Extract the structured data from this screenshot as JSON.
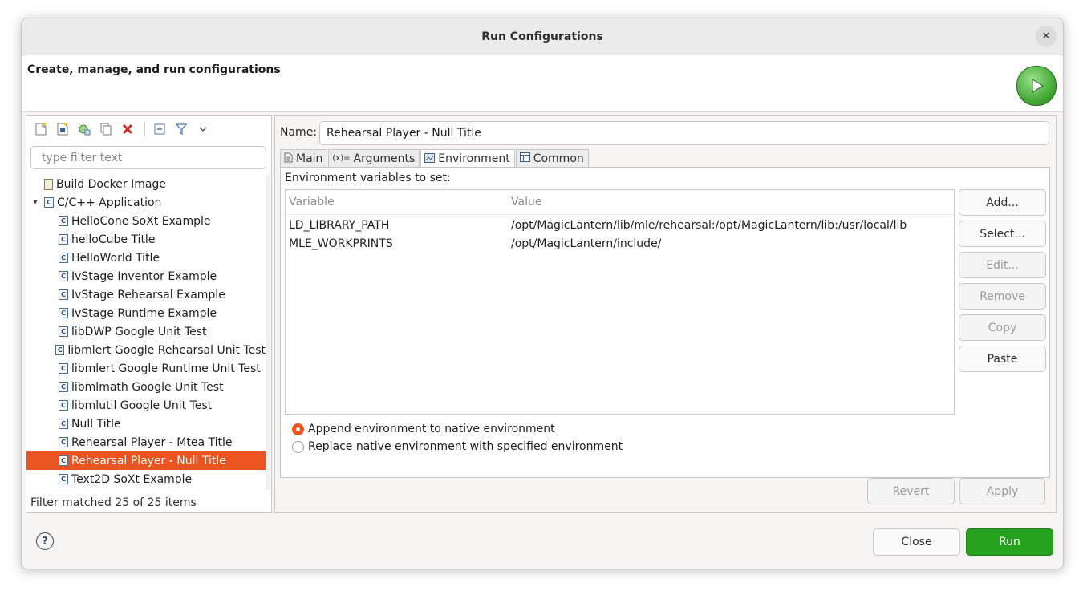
{
  "window": {
    "title": "Run Configurations",
    "close_glyph": "✕"
  },
  "banner": {
    "heading": "Create, manage, and run configurations",
    "icon": "run-icon"
  },
  "left": {
    "toolbar_icons": [
      "new-config-icon",
      "new-prototype-icon",
      "duplicate-icon",
      "copy-icon",
      "delete-icon",
      "collapse-all-icon",
      "filter-icon",
      "view-menu-icon"
    ],
    "filter_placeholder": "type filter text",
    "tree": [
      {
        "label": "Build Docker Image",
        "kind": "doc"
      },
      {
        "label": "C/C++ Application",
        "kind": "category",
        "expanded": true
      },
      {
        "label": "HelloCone SoXt Example",
        "kind": "c"
      },
      {
        "label": "helloCube Title",
        "kind": "c"
      },
      {
        "label": "HelloWorld Title",
        "kind": "c"
      },
      {
        "label": "IvStage Inventor Example",
        "kind": "c"
      },
      {
        "label": "IvStage Rehearsal Example",
        "kind": "c"
      },
      {
        "label": "IvStage Runtime Example",
        "kind": "c"
      },
      {
        "label": "libDWP Google Unit Test",
        "kind": "c"
      },
      {
        "label": "libmlert Google Rehearsal Unit Test",
        "kind": "c"
      },
      {
        "label": "libmlert Google Runtime Unit Test",
        "kind": "c"
      },
      {
        "label": "libmlmath Google Unit Test",
        "kind": "c"
      },
      {
        "label": "libmlutil Google Unit Test",
        "kind": "c"
      },
      {
        "label": "Null Title",
        "kind": "c"
      },
      {
        "label": "Rehearsal Player - Mtea Title",
        "kind": "c"
      },
      {
        "label": "Rehearsal Player - Null Title",
        "kind": "c",
        "selected": true
      },
      {
        "label": "Text2D SoXt Example",
        "kind": "c"
      }
    ],
    "status": "Filter matched 25 of 25 items"
  },
  "right": {
    "name_label": "Name:",
    "name_value": "Rehearsal Player - Null Title",
    "tabs": [
      {
        "label": "Main",
        "icon": "main-tab-icon"
      },
      {
        "label": "Arguments",
        "icon": "arguments-tab-icon"
      },
      {
        "label": "Environment",
        "icon": "environment-tab-icon",
        "active": true
      },
      {
        "label": "Common",
        "icon": "common-tab-icon"
      }
    ],
    "env_label": "Environment variables to set:",
    "columns": {
      "variable": "Variable",
      "value": "Value"
    },
    "variables": [
      {
        "name": "LD_LIBRARY_PATH",
        "value": "/opt/MagicLantern/lib/mle/rehearsal:/opt/MagicLantern/lib:/usr/local/lib"
      },
      {
        "name": "MLE_WORKPRINTS",
        "value": "/opt/MagicLantern/include/"
      }
    ],
    "buttons": [
      {
        "label": "Add...",
        "enabled": true
      },
      {
        "label": "Select...",
        "enabled": true
      },
      {
        "label": "Edit...",
        "enabled": false
      },
      {
        "label": "Remove",
        "enabled": false
      },
      {
        "label": "Copy",
        "enabled": false
      },
      {
        "label": "Paste",
        "enabled": true
      }
    ],
    "radio_append": "Append environment to native environment",
    "radio_replace": "Replace native environment with specified environment",
    "revert": "Revert",
    "apply": "Apply"
  },
  "footer": {
    "help_glyph": "?",
    "close": "Close",
    "run": "Run"
  },
  "colors": {
    "selection": "#e95420",
    "run_button": "#26a21f"
  }
}
